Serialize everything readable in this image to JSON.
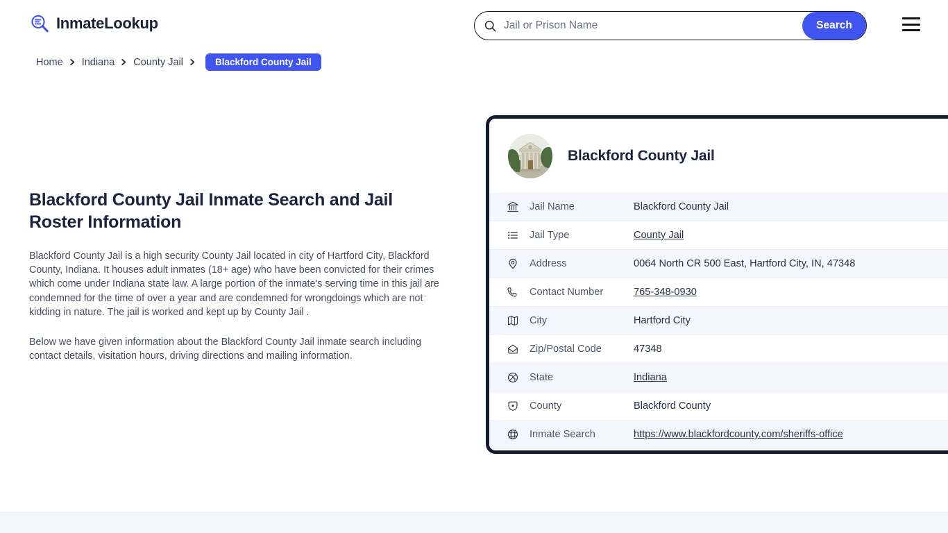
{
  "header": {
    "brand_name": "InmateLookup",
    "brand_icon": "magnifier-list-icon",
    "search": {
      "icon": "search-icon",
      "placeholder": "Jail or Prison Name",
      "value": "",
      "button_label": "Search"
    },
    "menu_icon": "hamburger-menu-icon"
  },
  "breadcrumb": {
    "items": [
      {
        "label": "Home",
        "current": false
      },
      {
        "label": "Indiana",
        "current": false
      },
      {
        "label": "County Jail",
        "current": false
      },
      {
        "label": "Blackford County Jail",
        "current": true
      }
    ],
    "separator_icon": "chevron-right-icon"
  },
  "main": {
    "title": "Blackford County Jail Inmate Search and Jail Roster Information",
    "paragraphs": [
      "Blackford County Jail is a high security County Jail located in city of Hartford City, Blackford County, Indiana. It houses adult inmates (18+ age) who have been convicted for their crimes which come under Indiana state law. A large portion of the inmate's serving time in this jail are condemned for the time of over a year and are condemned for wrongdoings which are not kidding in nature. The jail is worked and kept up by County Jail .",
      "Below we have given information about the Blackford County Jail inmate search including contact details, visitation hours, driving directions and mailing information."
    ]
  },
  "card": {
    "avatar_icon": "courthouse-photo",
    "title": "Blackford County Jail",
    "rows": [
      {
        "icon": "bank-icon",
        "label": "Jail Name",
        "value": "Blackford County Jail",
        "link": false
      },
      {
        "icon": "list-icon",
        "label": "Jail Type",
        "value": "County Jail",
        "link": true
      },
      {
        "icon": "pin-icon",
        "label": "Address",
        "value": "0064 North CR 500 East, Hartford City, IN, 47348",
        "link": false
      },
      {
        "icon": "phone-icon",
        "label": "Contact Number",
        "value": "765-348-0930",
        "link": true
      },
      {
        "icon": "map-icon",
        "label": "City",
        "value": "Hartford City",
        "link": false
      },
      {
        "icon": "envelope-icon",
        "label": "Zip/Postal Code",
        "value": "47348",
        "link": false
      },
      {
        "icon": "globe-icon",
        "label": "State",
        "value": "Indiana",
        "link": true
      },
      {
        "icon": "county-icon",
        "label": "County",
        "value": "Blackford County",
        "link": false
      },
      {
        "icon": "web-icon",
        "label": "Inmate Search",
        "value": "https://www.blackfordcounty.com/sheriffs-office",
        "link": true
      }
    ]
  },
  "colors": {
    "accent": "#4054f0",
    "link": "#3f51e0",
    "card_border": "#151c2f",
    "row_stripe": "#f5f6fd",
    "heading": "#1b233f",
    "body_text": "#474d5e"
  }
}
